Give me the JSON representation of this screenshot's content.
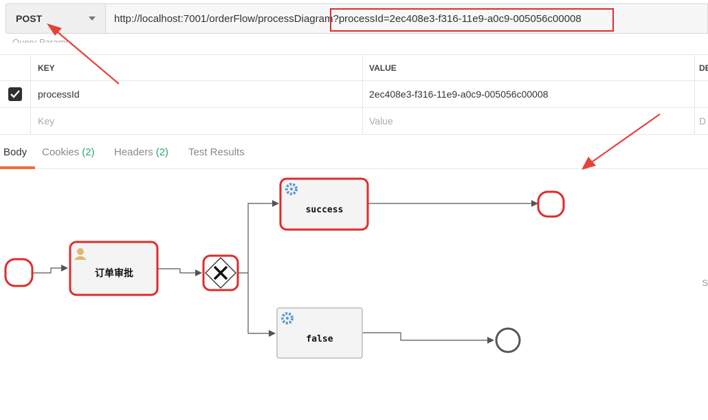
{
  "request": {
    "method": "POST",
    "url": "http://localhost:7001/orderFlow/processDiagram?processId=2ec408e3-f316-11e9-a0c9-005056c00008",
    "section_label_cutoff": "Query Params"
  },
  "params": {
    "headers": {
      "key": "KEY",
      "value": "VALUE",
      "desc": "DE"
    },
    "rows": [
      {
        "checked": true,
        "key": "processId",
        "value": "2ec408e3-f316-11e9-a0c9-005056c00008"
      }
    ],
    "placeholder": {
      "key": "Key",
      "value": "Value",
      "desc": "D"
    }
  },
  "tabs": [
    {
      "label": "Body",
      "count": ""
    },
    {
      "label": "Cookies",
      "count": "(2)"
    },
    {
      "label": "Headers",
      "count": "(2)"
    },
    {
      "label": "Test Results",
      "count": ""
    }
  ],
  "right_edge": "S",
  "diagram": {
    "tasks": {
      "approve": "订单审批",
      "success": "success",
      "false": "false"
    },
    "colors": {
      "highlight": "#e02a2a",
      "task_fill": "#f4f4f4",
      "task_border": "#bbbbbb",
      "edge": "#555555",
      "gear": "#5b9bd5",
      "user": "#e3b56b"
    }
  },
  "annotations": {
    "arrow_color": "#e8403a"
  }
}
